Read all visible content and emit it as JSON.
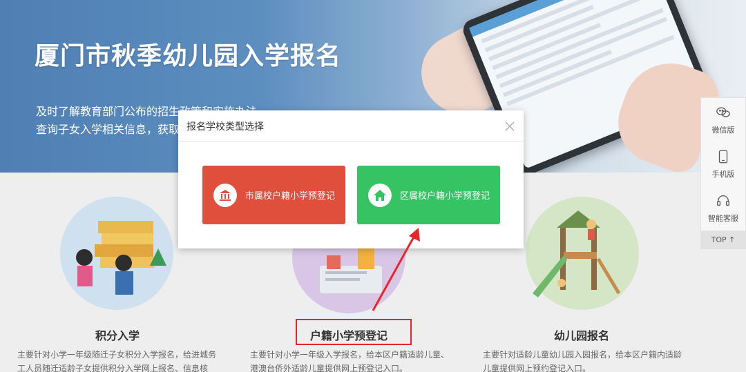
{
  "banner": {
    "title": "厦门市秋季幼儿园入学报名",
    "line1": "及时了解教育部门公布的招生政策和实施办法，",
    "line2": "查询子女入学相关信息，获取"
  },
  "sidebar": {
    "items": [
      {
        "label": "微信版",
        "icon": "wechat-icon"
      },
      {
        "label": "手机版",
        "icon": "mobile-icon"
      },
      {
        "label": "智能客服",
        "icon": "headset-icon"
      }
    ],
    "top_label": "TOP ↑"
  },
  "cards": [
    {
      "title": "积分入学",
      "desc1": "主要针对小学一年级随迁子女积分入学报名，给进城务",
      "desc2": "工人员随迁适龄子女提供积分入学网上报名、信息核"
    },
    {
      "title": "户籍小学预登记",
      "desc1": "主要针对小学一年级入学报名，给本区户籍适龄儿童、",
      "desc2": "港澳台侨外适龄儿童提供网上预登记入口。"
    },
    {
      "title": "幼儿园报名",
      "desc1": "主要针对适龄儿童幼儿园入园报名，给本区户籍内适龄",
      "desc2": "儿童提供网上预约登记入口。"
    }
  ],
  "modal": {
    "title": "报名学校类型选择",
    "option_city": "市属校户籍小学预登记",
    "option_district": "区属校户籍小学预登记"
  },
  "colors": {
    "red_button": "#e04e3c",
    "green_button": "#35c364",
    "annotation_red": "#e8252a"
  }
}
